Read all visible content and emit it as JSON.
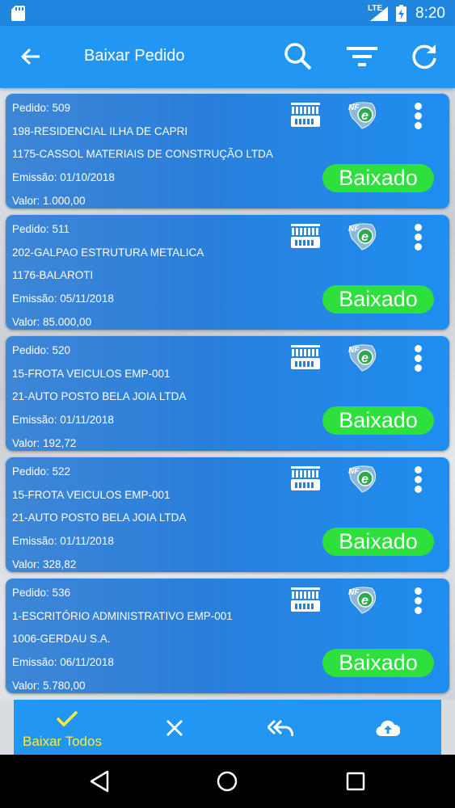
{
  "status_bar": {
    "network": "LTE",
    "time": "8:20"
  },
  "app_bar": {
    "title": "Baixar Pedido"
  },
  "icons": {
    "back": "arrow-left-icon",
    "search": "search-icon",
    "filter": "filter-icon",
    "refresh": "refresh-icon",
    "barcode": "barcode-icon",
    "nfe": "nfe-logo-icon",
    "more": "more-vertical-icon",
    "check": "check-icon",
    "close": "close-icon",
    "reply_all": "reply-all-icon",
    "upload": "cloud-upload-icon"
  },
  "colors": {
    "primary": "#2196f3",
    "status_bar": "#1f86e0",
    "status_pill": "#2ee03c",
    "bulk_label": "#ffeb3b"
  },
  "orders": [
    {
      "pedido": "Pedido: 509",
      "empresa": "198-RESIDENCIAL ILHA DE CAPRI",
      "cliente": "1175-CASSOL MATERIAIS DE CONSTRUÇÃO LTDA",
      "emissao": "Emissão: 01/10/2018",
      "valor": "Valor: 1.000,00",
      "status": "Baixado"
    },
    {
      "pedido": "Pedido: 511",
      "empresa": "202-GALPAO ESTRUTURA METALICA",
      "cliente": "1176-BALAROTI",
      "emissao": "Emissão: 05/11/2018",
      "valor": "Valor: 85.000,00",
      "status": "Baixado"
    },
    {
      "pedido": "Pedido: 520",
      "empresa": "15-FROTA VEICULOS EMP-001",
      "cliente": "21-AUTO POSTO BELA JOIA LTDA",
      "emissao": "Emissão: 01/11/2018",
      "valor": "Valor: 192,72",
      "status": "Baixado"
    },
    {
      "pedido": "Pedido: 522",
      "empresa": "15-FROTA VEICULOS EMP-001",
      "cliente": "21-AUTO POSTO BELA JOIA LTDA",
      "emissao": "Emissão: 01/11/2018",
      "valor": "Valor: 328,82",
      "status": "Baixado"
    },
    {
      "pedido": "Pedido: 536",
      "empresa": "1-ESCRITÓRIO ADMINISTRATIVO EMP-001",
      "cliente": "1006-GERDAU S.A.",
      "emissao": "Emissão: 06/11/2018",
      "valor": "Valor: 5.780,00",
      "status": "Baixado"
    }
  ],
  "bottom_bar": {
    "baixar_todos_label": "Baixar Todos"
  }
}
